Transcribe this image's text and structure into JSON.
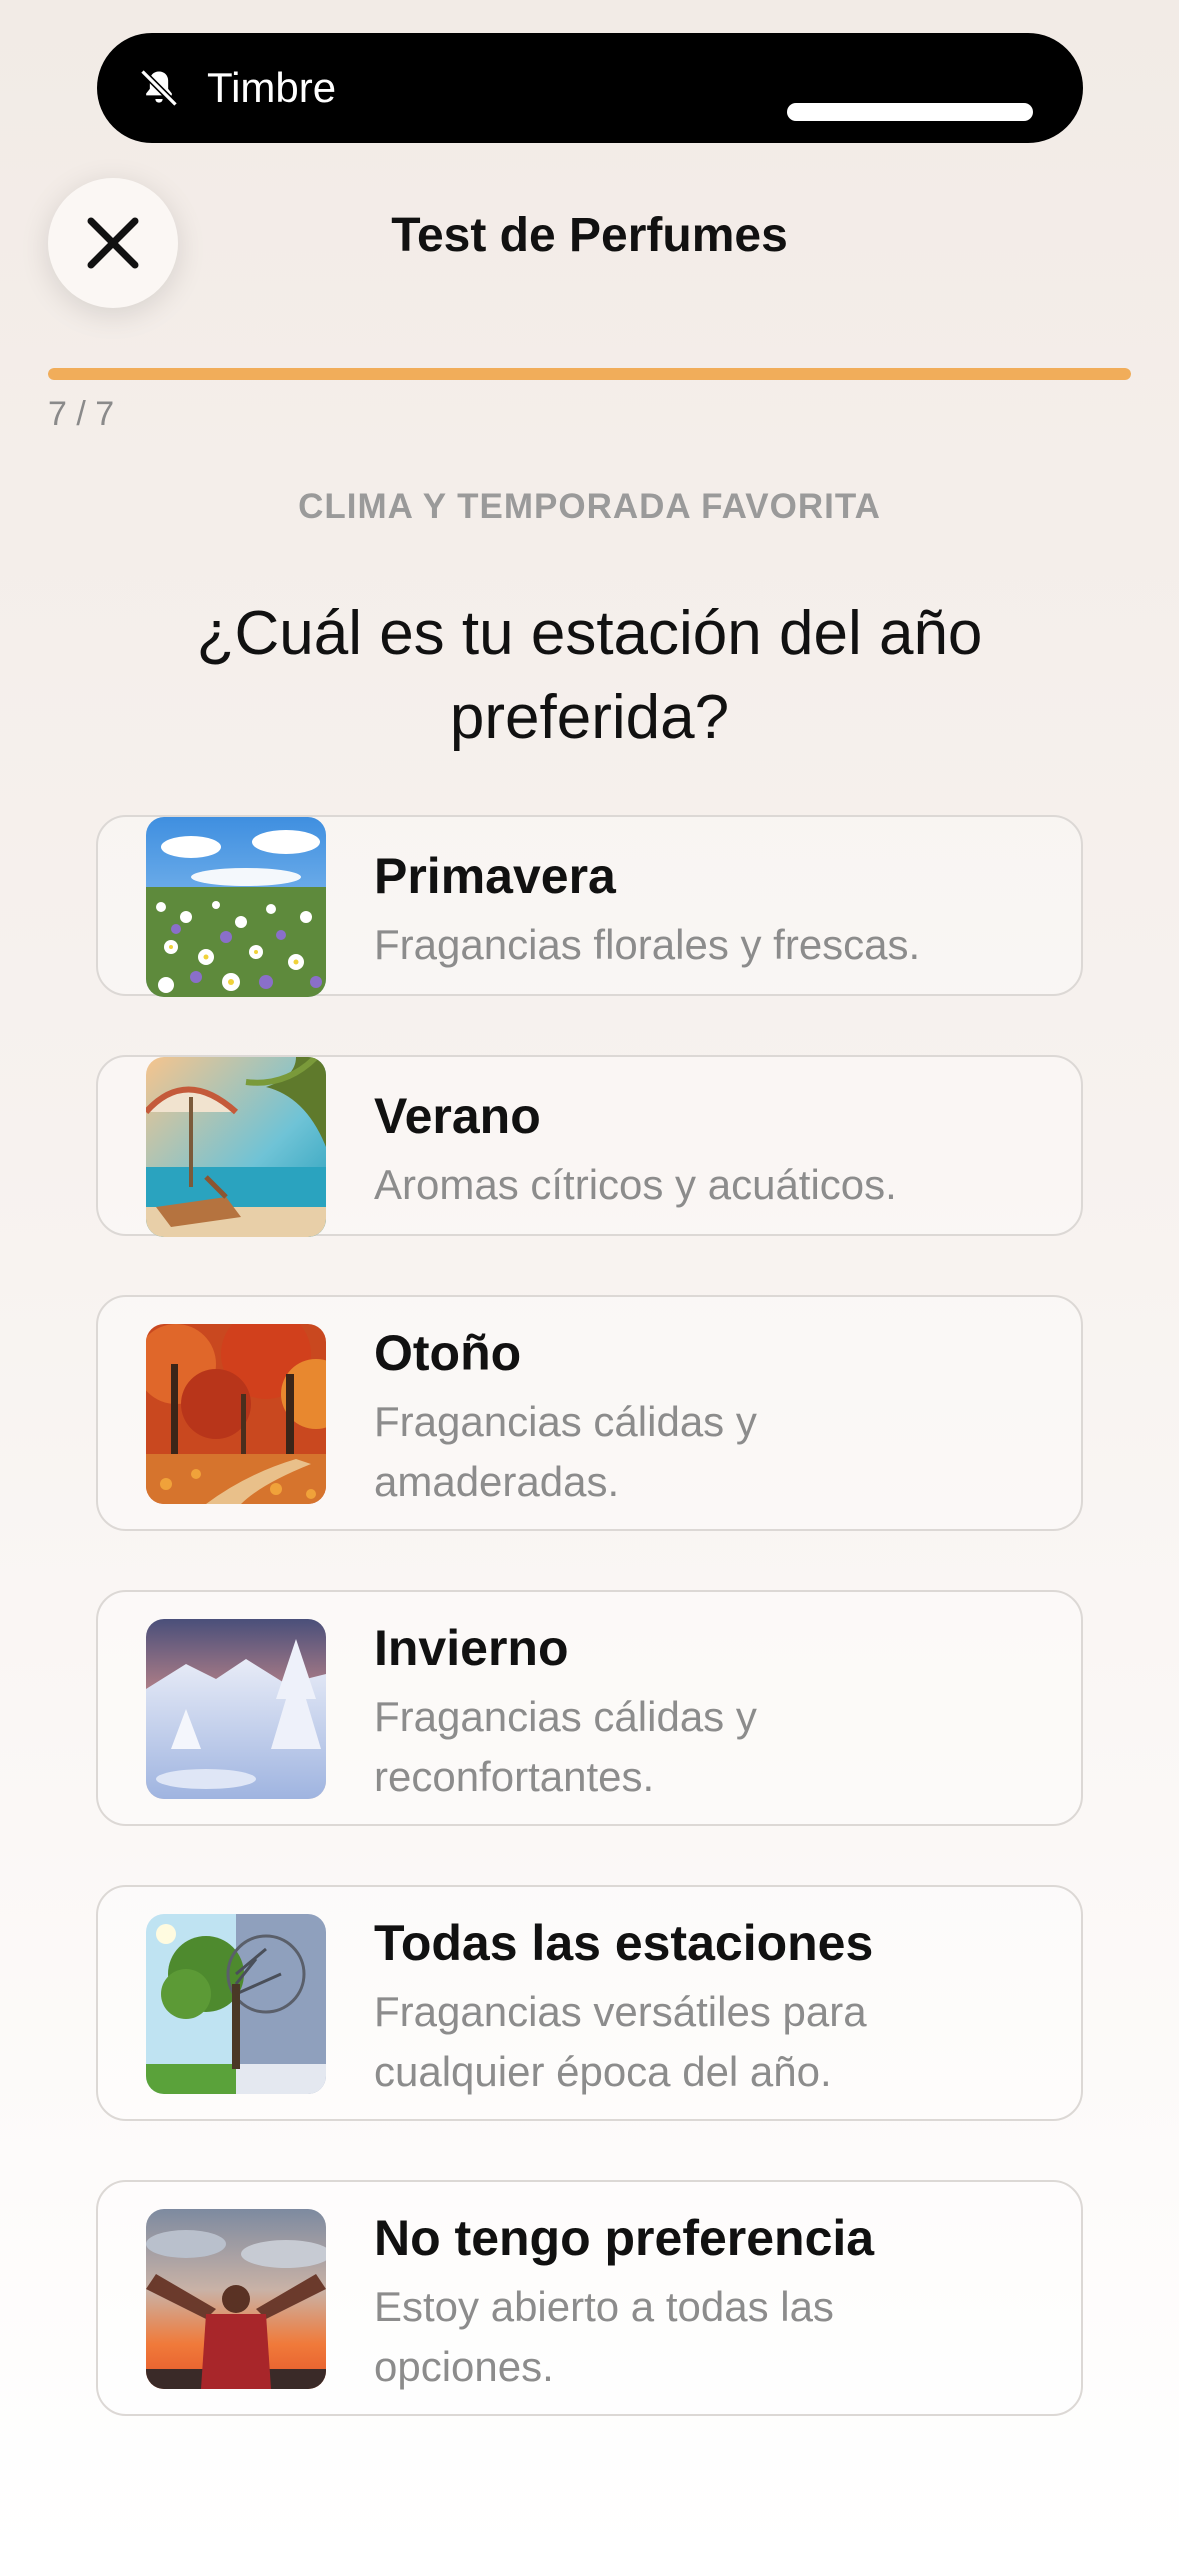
{
  "status": {
    "label": "Timbre",
    "icon": "bell-slash-icon"
  },
  "header": {
    "title": "Test de Perfumes",
    "close_icon": "close-icon"
  },
  "progress": {
    "text": "7 / 7",
    "fraction": 1.0,
    "color": "#f1ad5a"
  },
  "section_label": "CLIMA Y TEMPORADA FAVORITA",
  "question": "¿Cuál es tu estación del año preferida?",
  "options": [
    {
      "title": "Primavera",
      "description": "Fragancias florales y frescas.",
      "image": "spring-meadow-image"
    },
    {
      "title": "Verano",
      "description": "Aromas cítricos y acuáticos.",
      "image": "summer-beach-image"
    },
    {
      "title": "Otoño",
      "description": "Fragancias cálidas y amaderadas.",
      "image": "autumn-forest-image"
    },
    {
      "title": "Invierno",
      "description": "Fragancias cálidas y reconfortantes.",
      "image": "winter-snow-image"
    },
    {
      "title": "Todas las estaciones",
      "description": "Fragancias versátiles para cualquier época del año.",
      "image": "four-seasons-tree-image"
    },
    {
      "title": "No tengo preferencia",
      "description": "Estoy abierto a todas las opciones.",
      "image": "person-sunset-image"
    }
  ]
}
